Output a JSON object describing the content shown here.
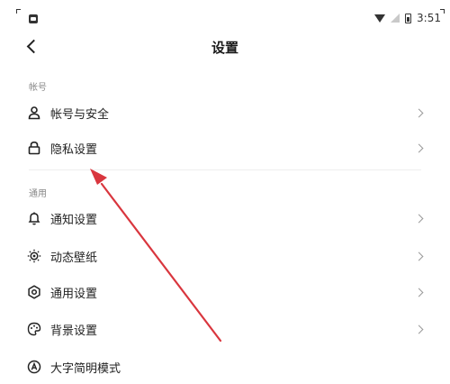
{
  "status": {
    "time": "3:51"
  },
  "header": {
    "title": "设置"
  },
  "sections": [
    {
      "label": "帐号"
    },
    {
      "label": "通用"
    }
  ],
  "items": [
    {
      "label": "帐号与安全",
      "icon": "user-icon"
    },
    {
      "label": "隐私设置",
      "icon": "lock-icon"
    },
    {
      "label": "通知设置",
      "icon": "bell-icon"
    },
    {
      "label": "动态壁纸",
      "icon": "dynamic-wallpaper-icon"
    },
    {
      "label": "通用设置",
      "icon": "settings-gear-icon"
    },
    {
      "label": "背景设置",
      "icon": "palette-icon"
    },
    {
      "label": "大字简明模式",
      "icon": "font-mode-icon"
    }
  ],
  "colors": {
    "annotation_arrow": "#d9363e"
  }
}
